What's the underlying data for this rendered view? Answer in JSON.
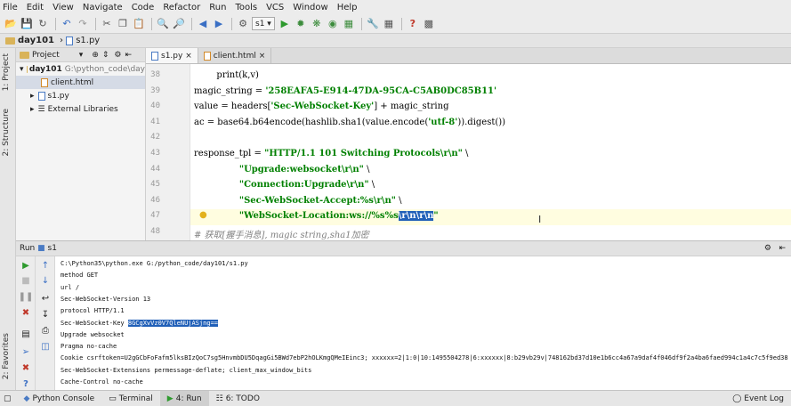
{
  "menu": [
    "File",
    "Edit",
    "View",
    "Navigate",
    "Code",
    "Refactor",
    "Run",
    "Tools",
    "VCS",
    "Window",
    "Help"
  ],
  "toolbar": {
    "run_config": "s1"
  },
  "breadcrumb": [
    "day101",
    "s1.py"
  ],
  "sidebar": {
    "project_tab": "1: Project",
    "structure_tab": "2: Structure",
    "favorites_tab": "2: Favorites"
  },
  "project": {
    "header": "Project",
    "root_name": "day101",
    "root_path": "G:\\python_code\\day",
    "files": [
      "client.html",
      "s1.py"
    ],
    "external": "External Libraries"
  },
  "editor": {
    "tabs": [
      {
        "label": "s1.py",
        "close": "×"
      },
      {
        "label": "client.html",
        "close": "×"
      }
    ],
    "line_numbers": [
      "38",
      "39",
      "40",
      "41",
      "42",
      "43",
      "44",
      "45",
      "46",
      "47",
      "48"
    ],
    "lines": [
      {
        "pre": "        print(k,v)",
        "str": "",
        "post": ""
      },
      {
        "pre": "magic_string = ",
        "str": "'258EAFA5-E914-47DA-95CA-C5AB0DC85B11'",
        "post": ""
      },
      {
        "pre": "value = headers[",
        "str": "'Sec-WebSocket-Key'",
        "post": "] + magic_string"
      },
      {
        "pre": "ac = base64.b64encode(hashlib.sha1(value.encode(",
        "str": "'utf-8'",
        "post": ")).digest())"
      },
      {
        "pre": "",
        "str": "",
        "post": ""
      },
      {
        "pre": "response_tpl = ",
        "str": "\"HTTP/1.1 101 Switching Protocols\\r\\n\"",
        "post": " \\"
      },
      {
        "pre": "                ",
        "str": "\"Upgrade:websocket\\r\\n\"",
        "post": " \\"
      },
      {
        "pre": "                ",
        "str": "\"Connection:Upgrade\\r\\n\"",
        "post": " \\"
      },
      {
        "pre": "                ",
        "str": "\"Sec-WebSocket-Accept:%s\\r\\n\"",
        "post": " \\"
      },
      {
        "pre": "                ",
        "str": "\"WebSocket-Location:ws://%s%s",
        "post": ""
      },
      {
        "pre": "",
        "str": "",
        "post": ""
      }
    ],
    "selected_text": "\\r\\n\\r\\n",
    "line47_end": "\"",
    "comment_line": "# 获取[握手消息], magic string,sha1加密"
  },
  "run": {
    "label": "Run",
    "config": "s1",
    "output": [
      "C:\\Python35\\python.exe G:/python_code/day101/s1.py",
      "method GET",
      "url /",
      "Sec-WebSocket-Version 13",
      "protocol HTTP/1.1",
      "Sec-WebSocket-Key ",
      "Upgrade websocket",
      "Pragma no-cache",
      "Cookie csrftoken=U2gGCbFoFafm5lksBIzQoC7sg5HnvmbDU5DqagGi5BWd7ebP2hOLKmgQMeIEinc3; xxxxxx=2|1:0|10:1495504278|6:xxxxxx|8:b29vb29v|748162bd37d10e1b6cc4a67a9daf4f046df9f2a4ba6faed994c1a4c7c5f9ed38",
      "Sec-WebSocket-Extensions permessage-deflate; client_max_window_bits",
      "Cache-Control no-cache"
    ],
    "key_value": "8GCgXvVz0V7QleNUjASjng=="
  },
  "statusbar": {
    "python_console": "Python Console",
    "terminal": "Terminal",
    "run": "4: Run",
    "todo": "6: TODO",
    "event_log": "Event Log"
  }
}
